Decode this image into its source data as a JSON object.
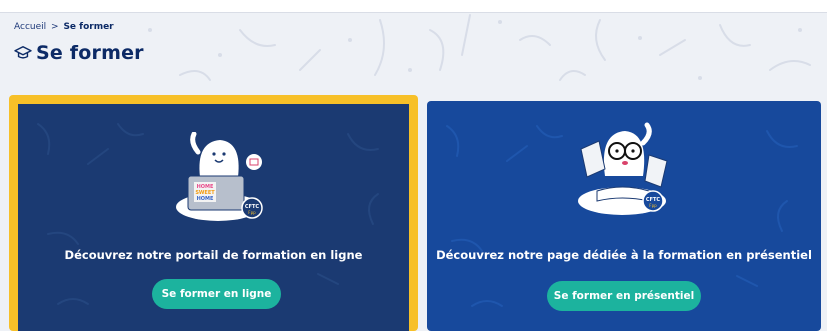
{
  "breadcrumb": {
    "home": "Accueil",
    "separator": ">",
    "current": "Se former"
  },
  "page": {
    "title": "Se former",
    "title_icon": "graduation-cap-icon"
  },
  "cards": [
    {
      "illustration": "mascot-laptop-home-sweet-home",
      "laptop_sticker": [
        "HOME",
        "SWEET",
        "HOME"
      ],
      "badge": "CFTC",
      "badge_sub": "Fpp",
      "title": "Découvrez notre portail de formation en ligne",
      "button": "Se former en ligne"
    },
    {
      "illustration": "mascot-glasses-book",
      "badge": "CFTC",
      "badge_sub": "Fpp",
      "title": "Découvrez notre page dédiée à la formation en présentiel",
      "button": "Se former en présentiel"
    }
  ],
  "colors": {
    "navy": "#0c2a66",
    "card1_bg": "#1b3a72",
    "card1_border": "#f7c028",
    "card2_bg": "#17499c",
    "button": "#1cb39e"
  }
}
